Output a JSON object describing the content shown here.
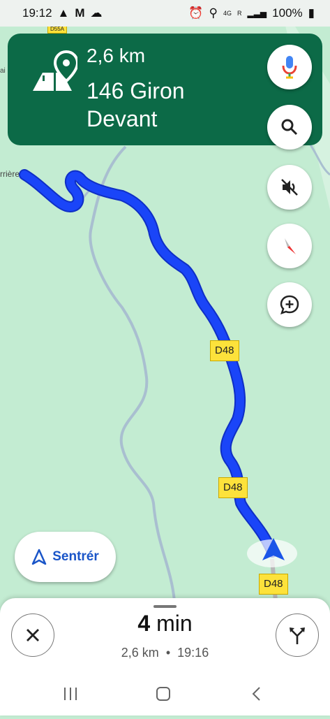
{
  "status_bar": {
    "time": "19:12",
    "network": "4G",
    "network_r": "R",
    "battery": "100%"
  },
  "map": {
    "top_road_label": "D55A",
    "place_left": "rrière",
    "place_edge": "ai",
    "road_labels": [
      "D48",
      "D48",
      "D48"
    ]
  },
  "directions": {
    "distance": "2,6 km",
    "street": "146 Giron Devant"
  },
  "controls": {
    "recenter_label": "Sentrér"
  },
  "trip": {
    "duration_value": "4",
    "duration_unit": "min",
    "remaining_distance": "2,6 km",
    "separator": "•",
    "arrival_time": "19:16"
  },
  "colors": {
    "banner": "#0c6a47",
    "route": "#1a3df5",
    "map_bg": "#c3ecd2",
    "accent": "#1a55c8"
  }
}
